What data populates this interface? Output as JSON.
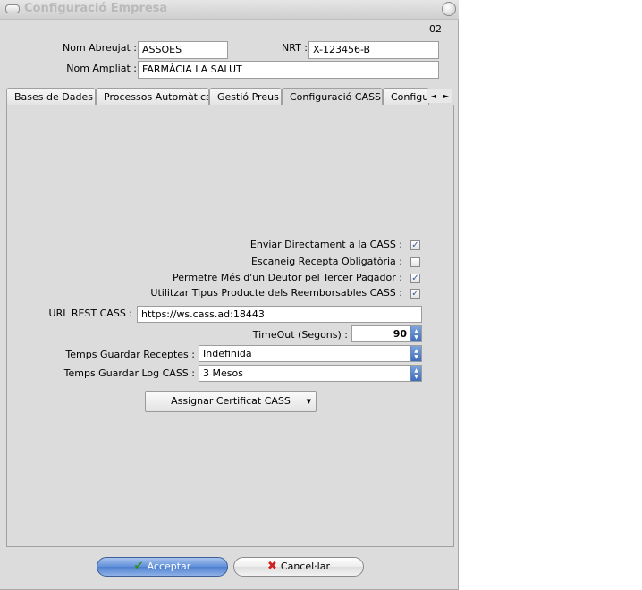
{
  "window": {
    "title": "Configuració Empresa",
    "code": "02"
  },
  "header": {
    "nom_abreujat_label": "Nom Abreujat :",
    "nom_abreujat_value": "ASSOES",
    "nrt_label": "NRT :",
    "nrt_value": "X-123456-B",
    "nom_ampliat_label": "Nom Ampliat :",
    "nom_ampliat_value": "FARMÀCIA  LA SALUT"
  },
  "tabs": [
    {
      "label": "Bases de Dades"
    },
    {
      "label": "Processos Automàtics"
    },
    {
      "label": "Gestió Preus"
    },
    {
      "label": "Configuració CASS"
    },
    {
      "label": "Configur"
    }
  ],
  "tab_scroll": {
    "left": "◄",
    "right": "►"
  },
  "cass": {
    "checkboxes": [
      {
        "label": "Enviar Directament a la CASS :",
        "checked": true
      },
      {
        "label": "Escaneig Recepta Obligatòria :",
        "checked": false
      },
      {
        "label": "Permetre Més d'un Deutor pel Tercer Pagador :",
        "checked": true
      },
      {
        "label": "Utilitzar Tipus Producte dels Reemborsables CASS :",
        "checked": true
      }
    ],
    "url_label": "URL REST CASS :",
    "url_value": "https://ws.cass.ad:18443",
    "timeout_label": "TimeOut (Segons) :",
    "timeout_value": "90",
    "temps_receptes_label": "Temps Guardar Receptes :",
    "temps_receptes_value": "Indefinida",
    "temps_log_label": "Temps Guardar Log CASS :",
    "temps_log_value": "3 Mesos",
    "certificat_button": "Assignar Certificat CASS"
  },
  "icons": {
    "check": "✔",
    "cross": "✖",
    "checkmark_box": "✓",
    "spin_up": "▲",
    "spin_down": "▼",
    "dropdown": "▼"
  },
  "footer": {
    "accept_label": "Acceptar",
    "cancel_label": "Cancel·lar"
  },
  "colors": {
    "accept_blue": "#5f8fd9",
    "ok_icon": "#2f8f20",
    "cancel_icon": "#d02020"
  }
}
